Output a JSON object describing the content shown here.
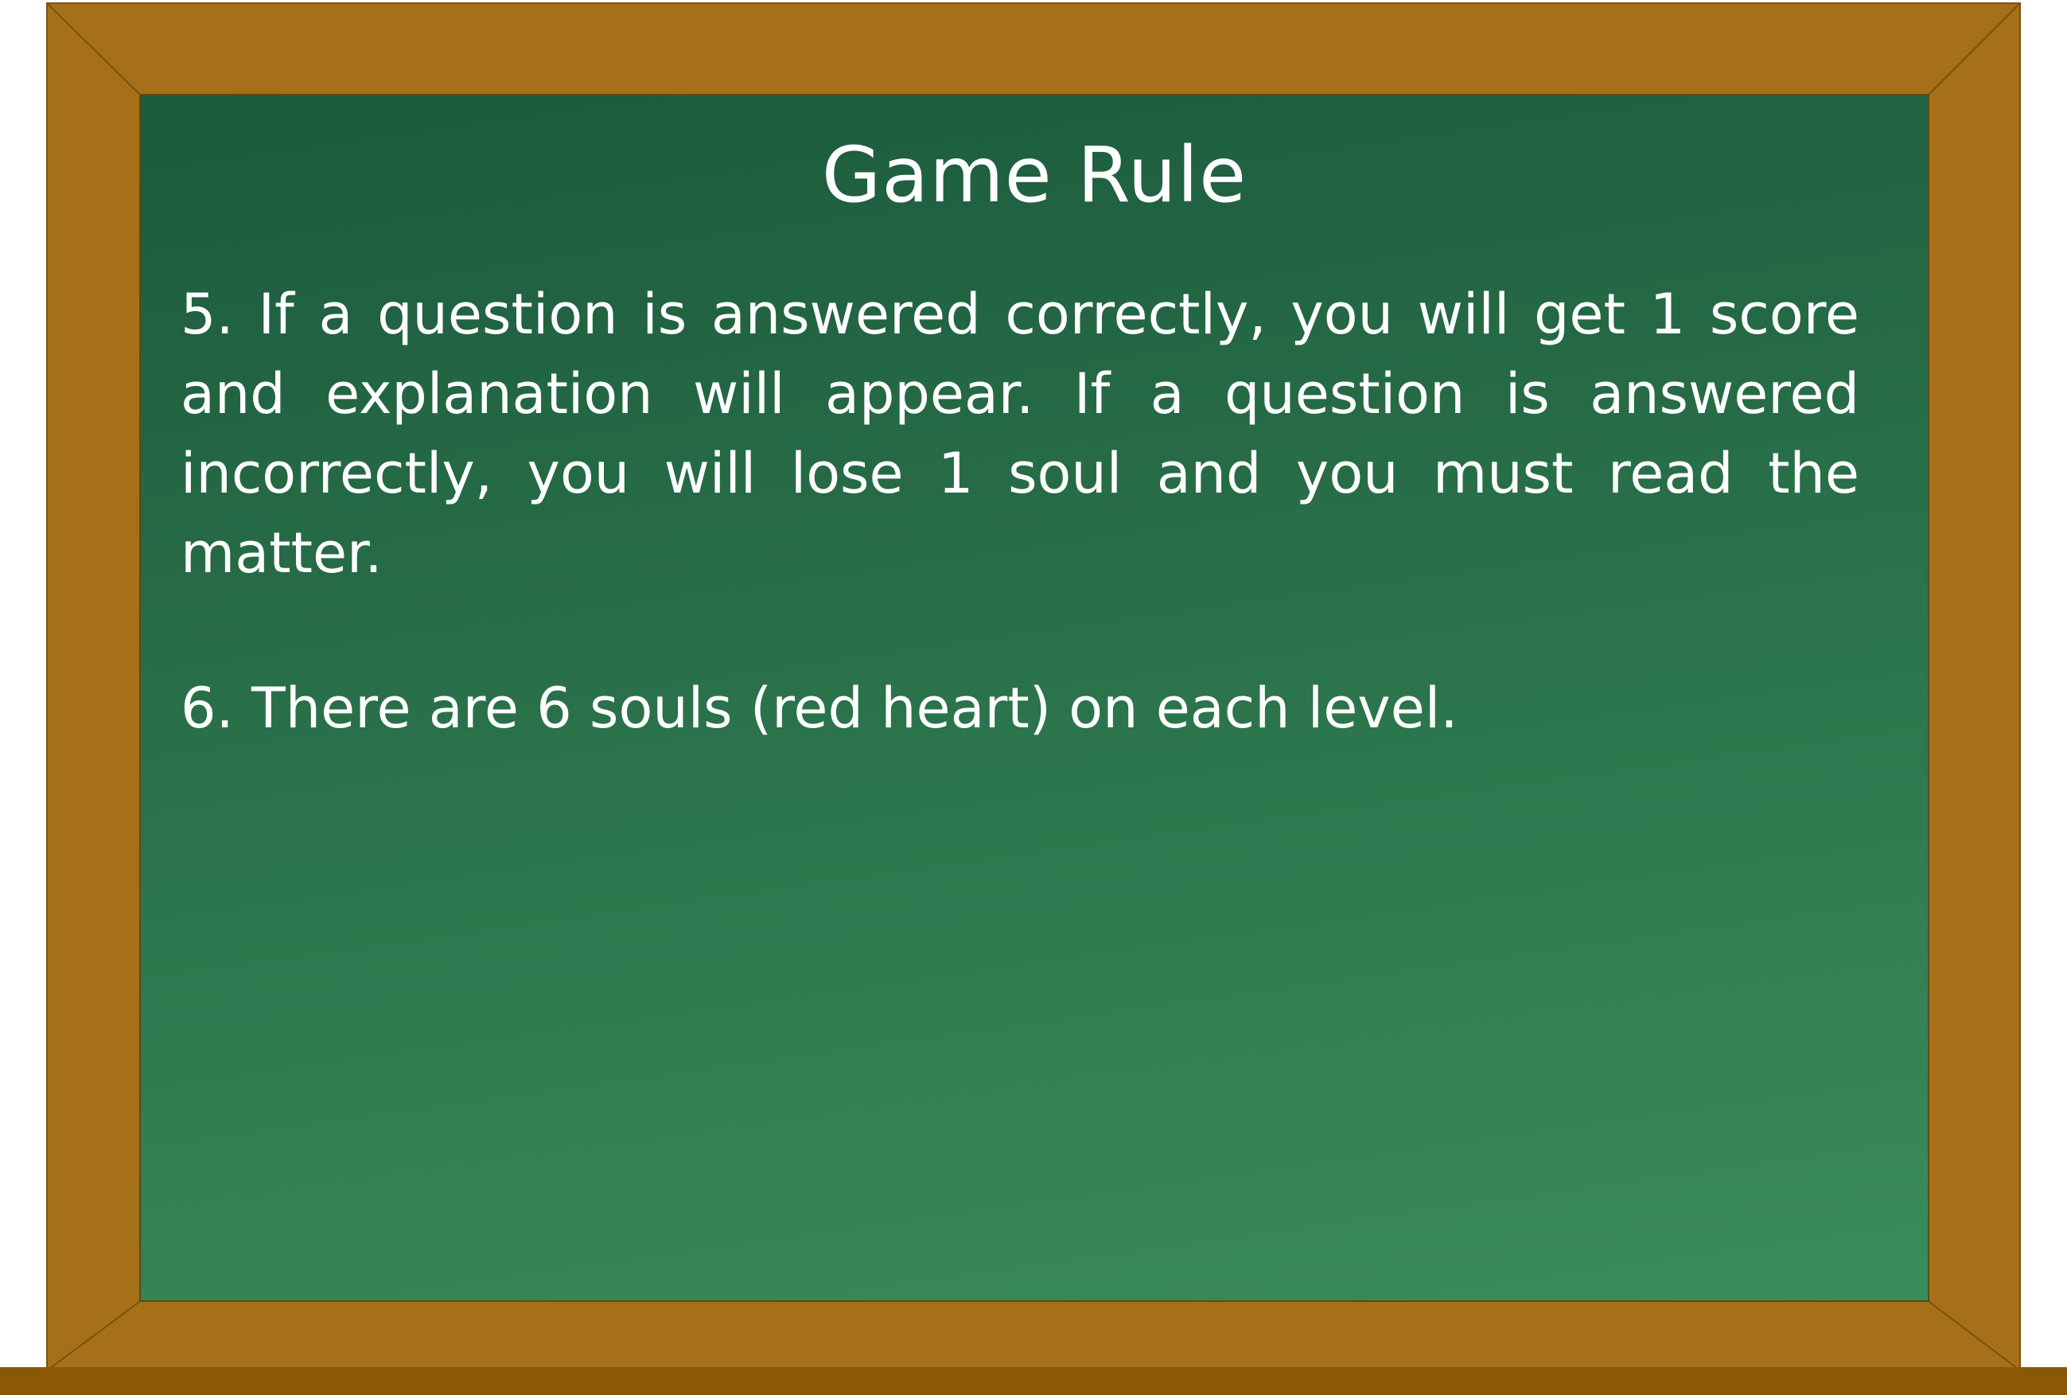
{
  "colors": {
    "frame": "#A57018",
    "ledge": "#8B5806",
    "board_top": "#1B5A3D",
    "board_bottom": "#3A8C5C",
    "text": "#FFFFFF"
  },
  "board": {
    "title": "Game Rule",
    "rules": [
      "5. If a question is answered correctly, you will get 1 score and explanation will appear. If a question is answered incorrectly, you will lose 1 soul and you must read the matter.",
      "6. There are 6 souls (red heart) on each level."
    ]
  }
}
